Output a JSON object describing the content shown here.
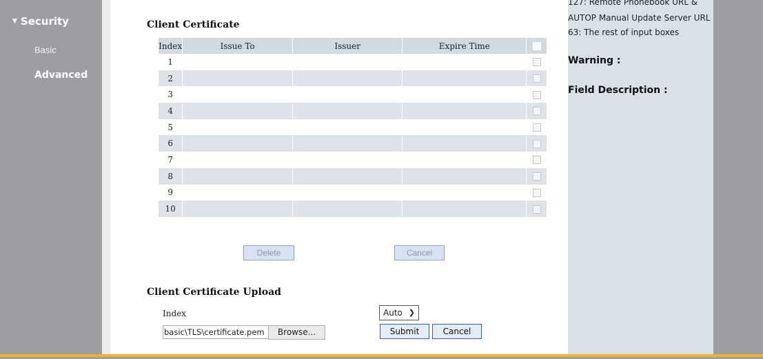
{
  "sidebar": {
    "section": "Security",
    "items": [
      {
        "label": "Basic"
      },
      {
        "label": "Advanced"
      }
    ]
  },
  "client_cert": {
    "title": "Client Certificate",
    "columns": [
      "Index",
      "Issue To",
      "Issuer",
      "Expire Time"
    ],
    "rows": [
      {
        "index": "1",
        "issue_to": "",
        "issuer": "",
        "expire": ""
      },
      {
        "index": "2",
        "issue_to": "",
        "issuer": "",
        "expire": ""
      },
      {
        "index": "3",
        "issue_to": "",
        "issuer": "",
        "expire": ""
      },
      {
        "index": "4",
        "issue_to": "",
        "issuer": "",
        "expire": ""
      },
      {
        "index": "5",
        "issue_to": "",
        "issuer": "",
        "expire": ""
      },
      {
        "index": "6",
        "issue_to": "",
        "issuer": "",
        "expire": ""
      },
      {
        "index": "7",
        "issue_to": "",
        "issuer": "",
        "expire": ""
      },
      {
        "index": "8",
        "issue_to": "",
        "issuer": "",
        "expire": ""
      },
      {
        "index": "9",
        "issue_to": "",
        "issuer": "",
        "expire": ""
      },
      {
        "index": "10",
        "issue_to": "",
        "issuer": "",
        "expire": ""
      }
    ],
    "delete_label": "Delete",
    "cancel_label": "Cancel"
  },
  "upload": {
    "title": "Client Certificate Upload",
    "index_label": "Index",
    "index_value": "Auto",
    "file_path": "basic\\TLS\\certificate.pem",
    "browse_label": "Browse...",
    "submit_label": "Submit",
    "cancel_label": "Cancel"
  },
  "help": {
    "lines": [
      "127: Remote Phonebook URL &",
      "AUTOP Manual Update Server URL",
      "63: The rest of input boxes"
    ],
    "warning": "Warning :",
    "field_description": "Field Description :"
  },
  "colors": {
    "sidebar_bg": "#9c9ea4",
    "table_header": "#d1d9e1",
    "help_bg": "#d8e0e8",
    "accent_line": "#f0b429"
  }
}
